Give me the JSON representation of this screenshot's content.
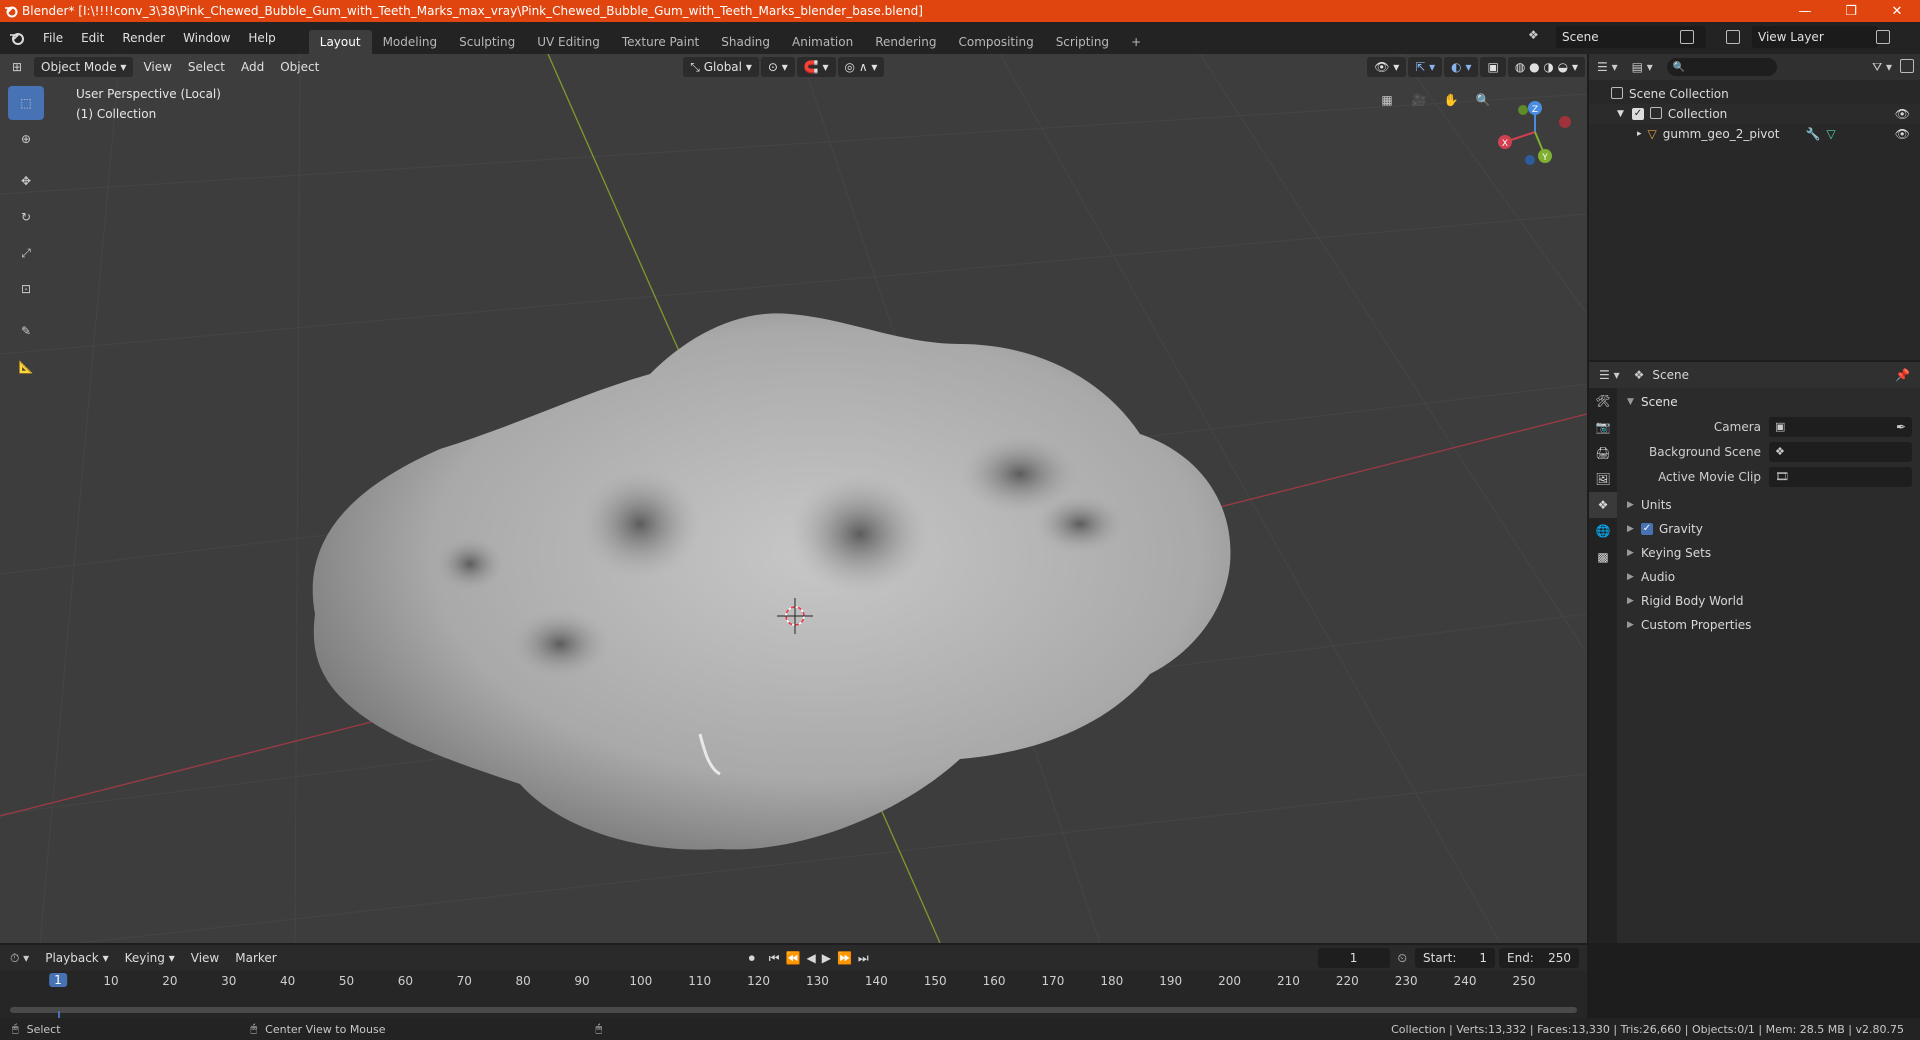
{
  "titlebar": {
    "title": "Blender* [I:\\!!!!conv_3\\38\\Pink_Chewed_Bubble_Gum_with_Teeth_Marks_max_vray\\Pink_Chewed_Bubble_Gum_with_Teeth_Marks_blender_base.blend]",
    "minimize": "—",
    "maximize": "❐",
    "close": "✕"
  },
  "menu": {
    "file": "File",
    "edit": "Edit",
    "render": "Render",
    "window": "Window",
    "help": "Help"
  },
  "workspaces": [
    "Layout",
    "Modeling",
    "Sculpting",
    "UV Editing",
    "Texture Paint",
    "Shading",
    "Animation",
    "Rendering",
    "Compositing",
    "Scripting"
  ],
  "workspace_add": "+",
  "scene": {
    "name": "Scene",
    "view_layer": "View Layer"
  },
  "viewport": {
    "mode": "Object Mode",
    "menus": {
      "view": "View",
      "select": "Select",
      "add": "Add",
      "object": "Object"
    },
    "orientation": "Global",
    "info_line1": "User Perspective (Local)",
    "info_line2": "(1) Collection",
    "gizmo": {
      "x": "X",
      "y": "Y",
      "z": "Z"
    }
  },
  "outliner": {
    "root": "Scene Collection",
    "collection": "Collection",
    "object": "gumm_geo_2_pivot"
  },
  "properties": {
    "header": "Scene",
    "panel": "Scene",
    "camera_label": "Camera",
    "background_label": "Background Scene",
    "clip_label": "Active Movie Clip",
    "subpanels": {
      "units": "Units",
      "gravity": "Gravity",
      "keying": "Keying Sets",
      "audio": "Audio",
      "rigid": "Rigid Body World",
      "custom": "Custom Properties"
    }
  },
  "timeline": {
    "playback": "Playback",
    "keying": "Keying",
    "view": "View",
    "marker": "Marker",
    "current_frame": "1",
    "start_label": "Start:",
    "start": "1",
    "end_label": "End:",
    "end": "250",
    "ticks": [
      "10",
      "20",
      "30",
      "40",
      "50",
      "60",
      "70",
      "80",
      "90",
      "100",
      "110",
      "120",
      "130",
      "140",
      "150",
      "160",
      "170",
      "180",
      "190",
      "200",
      "210",
      "220",
      "230",
      "240",
      "250"
    ]
  },
  "status": {
    "select": "Select",
    "center": "Center View to Mouse",
    "stats": "Collection | Verts:13,332 | Faces:13,330 | Tris:26,660 | Objects:0/1 | Mem: 28.5 MB | v2.80.75"
  },
  "colors": {
    "accent": "#4772b3",
    "titlebar": "#e0450f",
    "x_axis": "#c0394b",
    "y_axis": "#8ab830"
  }
}
